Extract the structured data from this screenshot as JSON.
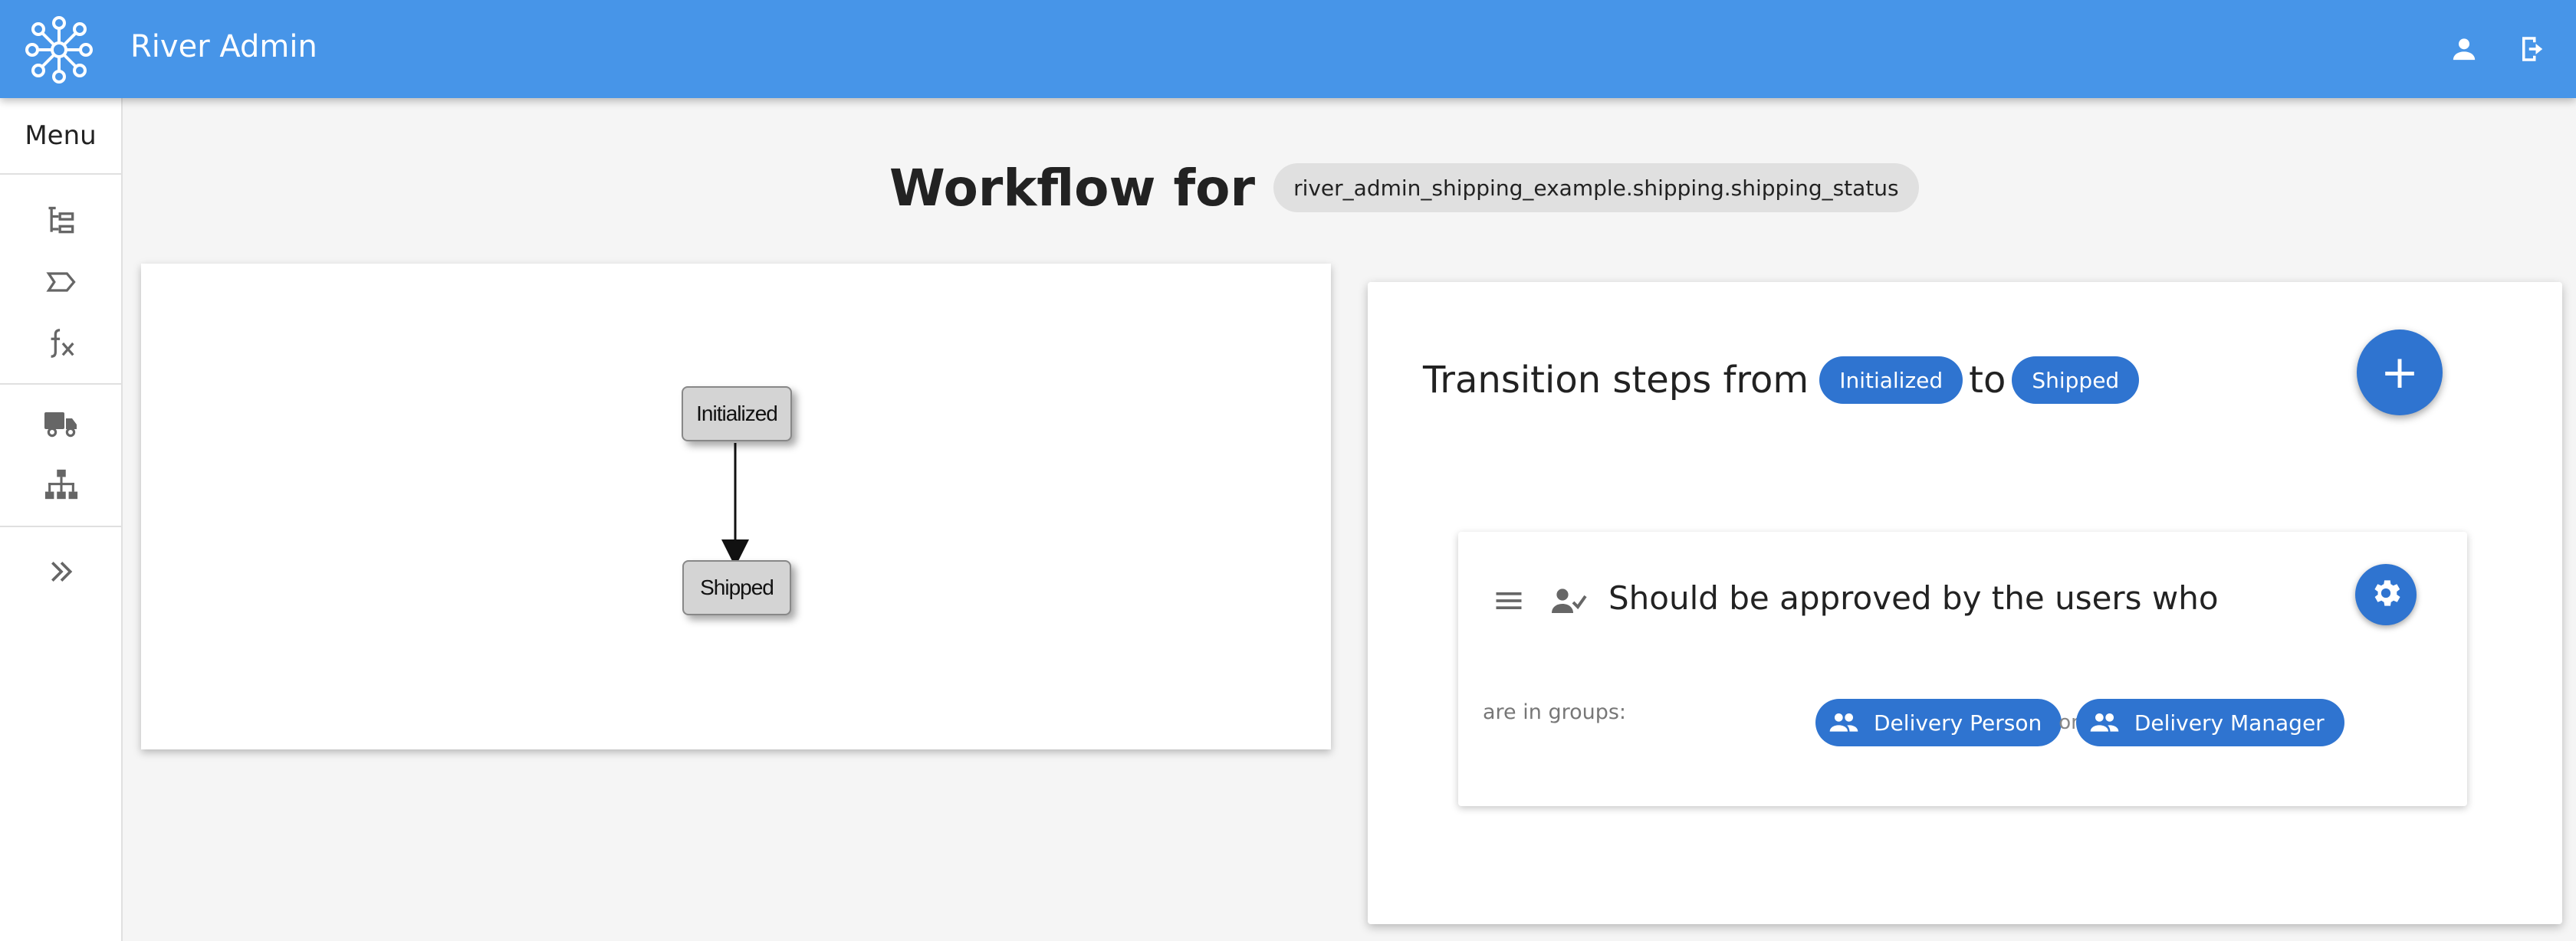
{
  "app": {
    "title": "River Admin"
  },
  "sidebar": {
    "menu_label": "Menu",
    "items": [
      {
        "icon": "tree-structure-icon"
      },
      {
        "icon": "label-arrow-icon"
      },
      {
        "icon": "function-icon"
      },
      {
        "icon": "truck-icon"
      },
      {
        "icon": "sitemap-icon"
      },
      {
        "icon": "expand-double-chevron-icon"
      }
    ]
  },
  "page": {
    "heading": "Workflow for",
    "workflow_id": "river_admin_shipping_example.shipping.shipping_status"
  },
  "diagram": {
    "states": [
      "Initialized",
      "Shipped"
    ]
  },
  "transition": {
    "heading_prefix": "Transition steps from",
    "from_state": "Initialized",
    "connector": "to",
    "to_state": "Shipped",
    "add_label": "+"
  },
  "step": {
    "title": "Should be approved by the users who",
    "groups_label": "are in groups:",
    "groups": [
      "Delivery Person",
      "Delivery Manager"
    ],
    "separator": "or"
  },
  "colors": {
    "appbar": "#4795e8",
    "accent": "#2f74d0",
    "chip_grey": "#e0e0e0"
  }
}
